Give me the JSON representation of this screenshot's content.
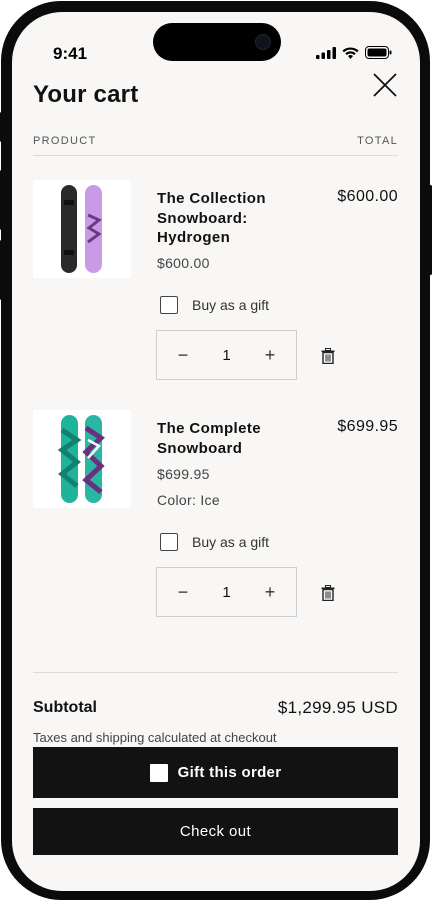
{
  "status": {
    "time": "9:41"
  },
  "cart": {
    "title": "Your cart",
    "columns": {
      "product": "PRODUCT",
      "total": "TOTAL"
    },
    "items": [
      {
        "name": "The Collection Snowboard: Hydrogen",
        "price": "$600.00",
        "total": "$600.00",
        "variant": "",
        "gift_label": "Buy as a gift",
        "gift_checked": false,
        "quantity": "1",
        "minus": "−",
        "plus": "+"
      },
      {
        "name": "The Complete Snowboard",
        "price": "$699.95",
        "total": "$699.95",
        "variant": "Color: Ice",
        "gift_label": "Buy as a gift",
        "gift_checked": false,
        "quantity": "1",
        "minus": "−",
        "plus": "+"
      }
    ],
    "subtotal_label": "Subtotal",
    "subtotal_value": "$1,299.95 USD",
    "taxes_note": "Taxes and shipping calculated at checkout",
    "gift_order_label": "Gift this order",
    "checkout_label": "Check out"
  },
  "icons": {
    "close": "close-icon",
    "trash": "trash-icon",
    "signal": "signal-icon",
    "wifi": "wifi-icon",
    "battery": "battery-icon"
  },
  "colors": {
    "background": "#f8f7f5",
    "button": "#121212",
    "hydrogen_board": "#c99be6",
    "ice_board": "#1fb39a"
  }
}
